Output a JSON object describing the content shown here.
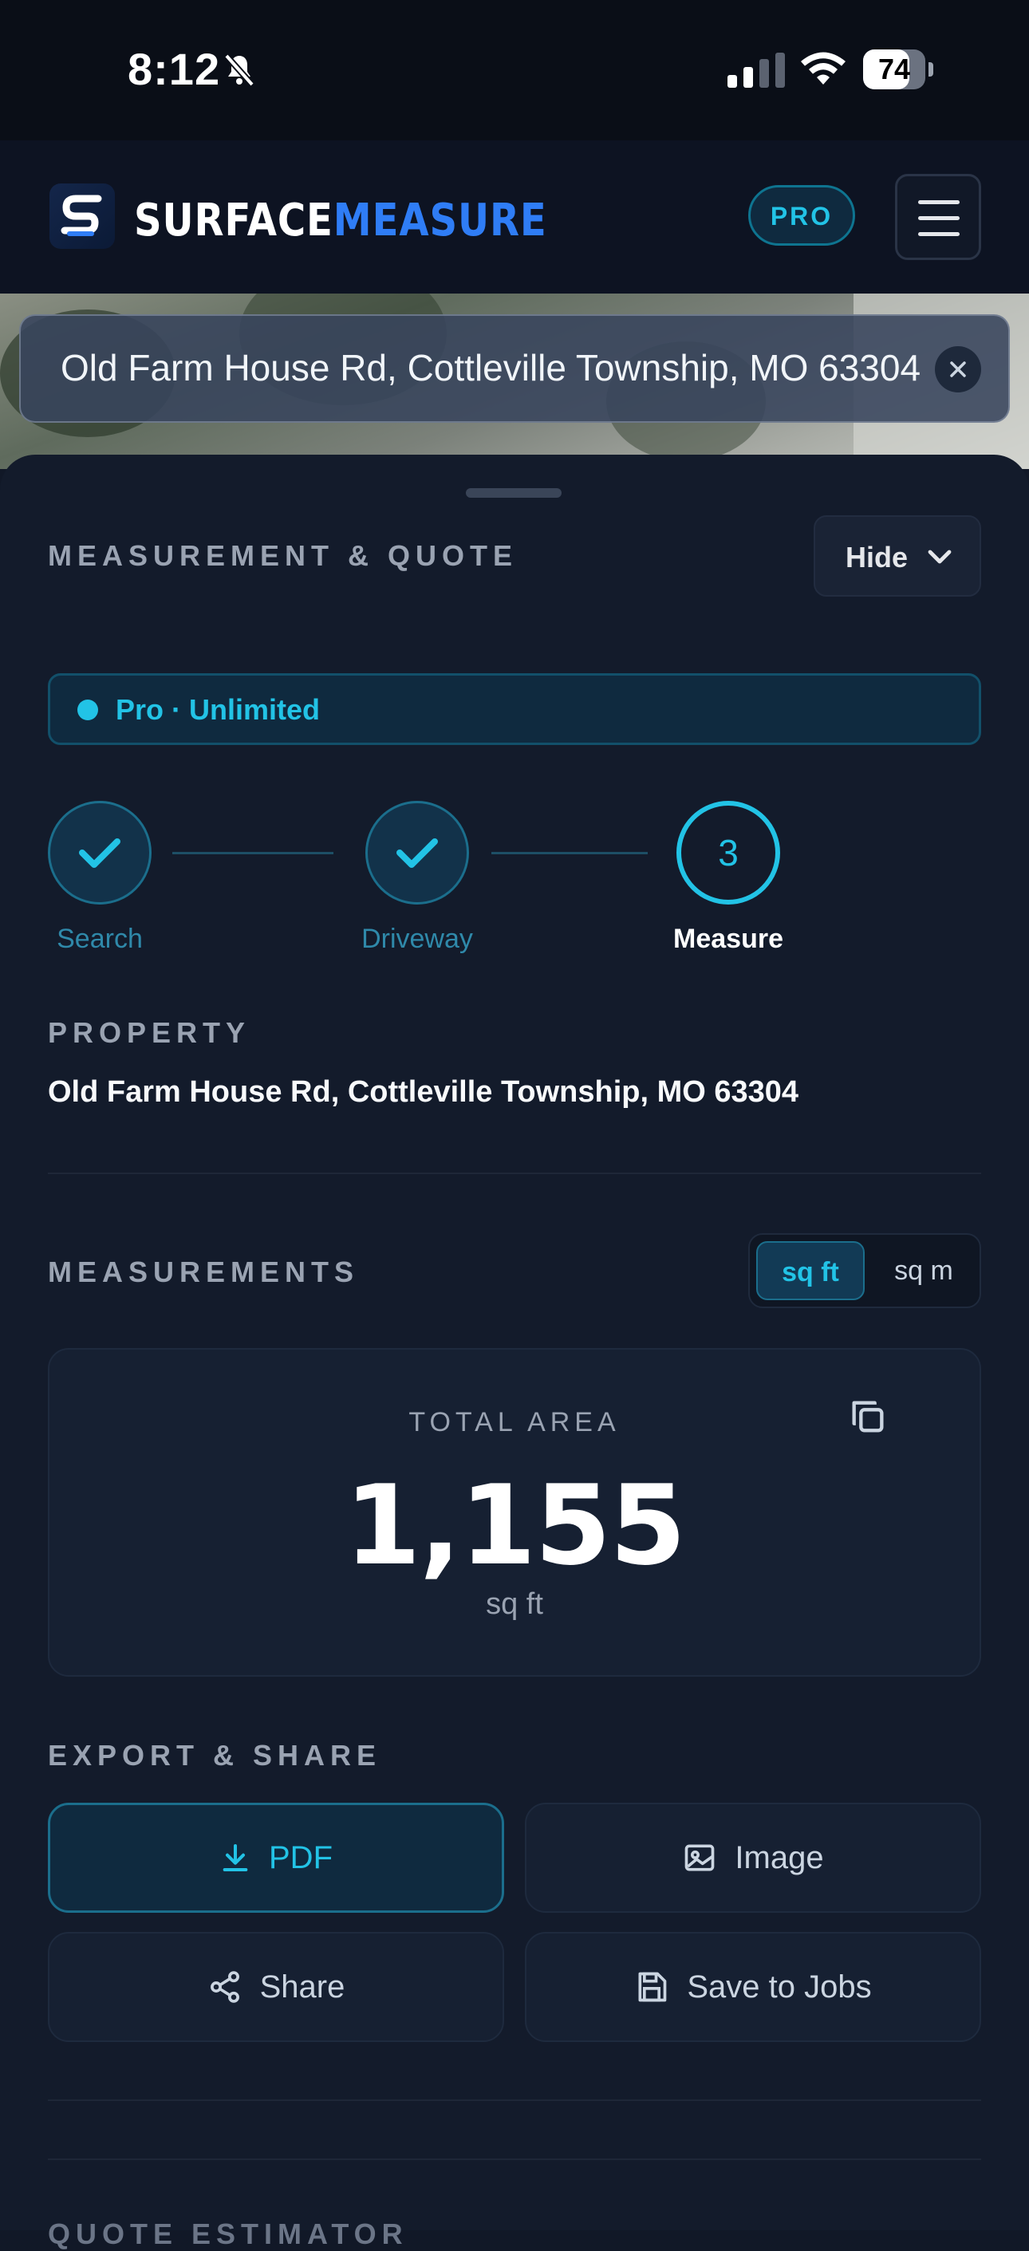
{
  "status_bar": {
    "time": "8:12",
    "battery": "74",
    "battery_level": 0.74
  },
  "header": {
    "logo_part1": "SURFACE",
    "logo_part2": "MEASURE",
    "pro_badge": "PRO"
  },
  "search": {
    "address": "Old Farm House Rd, Cottleville Township, MO 63304"
  },
  "panel": {
    "title": "MEASUREMENT & QUOTE",
    "hide_label": "Hide"
  },
  "plan": {
    "label": "Pro · Unlimited"
  },
  "steps": [
    {
      "label": "Search",
      "state": "done"
    },
    {
      "label": "Driveway",
      "state": "done"
    },
    {
      "number": "3",
      "label": "Measure",
      "state": "current"
    }
  ],
  "property": {
    "heading": "PROPERTY",
    "address": "Old Farm House Rd, Cottleville Township, MO 63304"
  },
  "measurements": {
    "heading": "MEASUREMENTS",
    "units": [
      "sq ft",
      "sq m"
    ],
    "selected_unit": "sq ft",
    "total_label": "TOTAL AREA",
    "total_value": "1,155",
    "total_unit": "sq ft"
  },
  "export": {
    "heading": "EXPORT & SHARE",
    "pdf": "PDF",
    "image": "Image",
    "share": "Share",
    "save": "Save to Jobs"
  },
  "next_section": {
    "heading": "QUOTE ESTIMATOR"
  },
  "colors": {
    "accent": "#22c3e6",
    "brand_blue": "#2f7df6",
    "background": "#131b2b"
  }
}
